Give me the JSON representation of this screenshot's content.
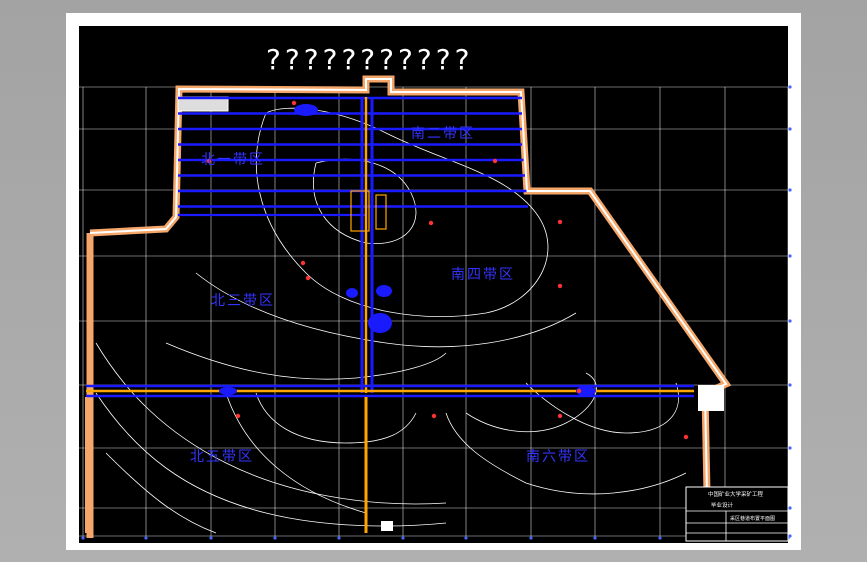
{
  "drawing": {
    "title": "???????????",
    "zones": [
      {
        "id": "north-1",
        "label": "北一带区"
      },
      {
        "id": "south-2",
        "label": "南二带区"
      },
      {
        "id": "north-3",
        "label": "北三带区"
      },
      {
        "id": "south-4",
        "label": "南四带区"
      },
      {
        "id": "north-5",
        "label": "北五带区"
      },
      {
        "id": "south-6",
        "label": "南六带区"
      }
    ],
    "title_block": {
      "company": "中国矿业大学采矿工程",
      "project": "毕业设计",
      "drawing_name": "采区巷道布置平面图"
    }
  },
  "colors": {
    "background": "#000000",
    "sheet": "#ffffff",
    "grid": "#ffffff",
    "roadway": "#1a1aff",
    "belt": "#ffa500",
    "contour": "#ffffff",
    "boundary": "#ffffff",
    "boundary_fill": "#f5a76b",
    "zone_label": "#3333ff",
    "borehole": "#ff3333"
  }
}
